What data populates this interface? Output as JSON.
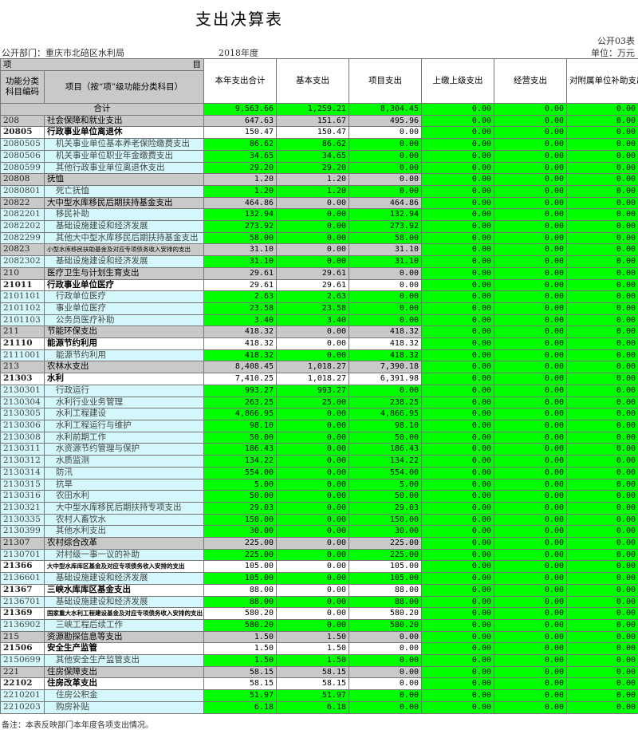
{
  "title": "支出决算表",
  "form_no": "公开03表",
  "department": "公开部门：重庆市北碚区水利局",
  "year": "2018年度",
  "unit": "单位：万元",
  "header": {
    "item_label": "项",
    "item_label_right": "目",
    "code": "功能分类科目编码",
    "name": "项目（按“项”级功能分类科目）",
    "col1": "本年支出合计",
    "col2": "基本支出",
    "col3": "项目支出",
    "col4": "上缴上级支出",
    "col5": "经营支出",
    "col6": "对附属单位补助支出"
  },
  "rows": [
    {
      "code": "",
      "name": "合计",
      "v": [
        "9,563.66",
        "1,259.21",
        "8,304.45",
        "0.00",
        "0.00",
        "0.00"
      ],
      "type": "total"
    },
    {
      "code": "208",
      "name": "社会保障和就业支出",
      "v": [
        "647.63",
        "151.67",
        "495.96",
        "0.00",
        "0.00",
        "0.00"
      ],
      "type": "grey"
    },
    {
      "code": "20805",
      "name": "行政事业单位离退休",
      "v": [
        "150.47",
        "150.47",
        "0.00",
        "0.00",
        "0.00",
        "0.00"
      ],
      "type": "white"
    },
    {
      "code": "2080505",
      "name": "机关事业单位基本养老保险缴费支出",
      "v": [
        "86.62",
        "86.62",
        "0.00",
        "0.00",
        "0.00",
        "0.00"
      ],
      "type": "light"
    },
    {
      "code": "2080506",
      "name": "机关事业单位职业年金缴费支出",
      "v": [
        "34.65",
        "34.65",
        "0.00",
        "0.00",
        "0.00",
        "0.00"
      ],
      "type": "light"
    },
    {
      "code": "2080599",
      "name": "其他行政事业单位离退休支出",
      "v": [
        "29.20",
        "29.20",
        "0.00",
        "0.00",
        "0.00",
        "0.00"
      ],
      "type": "light"
    },
    {
      "code": "20808",
      "name": "抚恤",
      "v": [
        "1.20",
        "1.20",
        "0.00",
        "0.00",
        "0.00",
        "0.00"
      ],
      "type": "grey"
    },
    {
      "code": "2080801",
      "name": "死亡抚恤",
      "v": [
        "1.20",
        "1.20",
        "0.00",
        "0.00",
        "0.00",
        "0.00"
      ],
      "type": "light"
    },
    {
      "code": "20822",
      "name": "大中型水库移民后期扶持基金支出",
      "v": [
        "464.86",
        "0.00",
        "464.86",
        "0.00",
        "0.00",
        "0.00"
      ],
      "type": "grey"
    },
    {
      "code": "2082201",
      "name": "移民补助",
      "v": [
        "132.94",
        "0.00",
        "132.94",
        "0.00",
        "0.00",
        "0.00"
      ],
      "type": "light"
    },
    {
      "code": "2082202",
      "name": "基础设施建设和经济发展",
      "v": [
        "273.92",
        "0.00",
        "273.92",
        "0.00",
        "0.00",
        "0.00"
      ],
      "type": "light"
    },
    {
      "code": "2082299",
      "name": "其他大中型水库移民后期扶持基金支出",
      "v": [
        "58.00",
        "0.00",
        "58.00",
        "0.00",
        "0.00",
        "0.00"
      ],
      "type": "light"
    },
    {
      "code": "20823",
      "name": "小型水库移民扶助基金及对应专项债务收入安排的支出",
      "v": [
        "31.10",
        "0.00",
        "31.10",
        "0.00",
        "0.00",
        "0.00"
      ],
      "type": "grey",
      "small": true
    },
    {
      "code": "2082302",
      "name": "基础设施建设和经济发展",
      "v": [
        "31.10",
        "0.00",
        "31.10",
        "0.00",
        "0.00",
        "0.00"
      ],
      "type": "light"
    },
    {
      "code": "210",
      "name": "医疗卫生与计划生育支出",
      "v": [
        "29.61",
        "29.61",
        "0.00",
        "0.00",
        "0.00",
        "0.00"
      ],
      "type": "grey"
    },
    {
      "code": "21011",
      "name": "行政事业单位医疗",
      "v": [
        "29.61",
        "29.61",
        "0.00",
        "0.00",
        "0.00",
        "0.00"
      ],
      "type": "white"
    },
    {
      "code": "2101101",
      "name": "行政单位医疗",
      "v": [
        "2.63",
        "2.63",
        "0.00",
        "0.00",
        "0.00",
        "0.00"
      ],
      "type": "light"
    },
    {
      "code": "2101102",
      "name": "事业单位医疗",
      "v": [
        "23.58",
        "23.58",
        "0.00",
        "0.00",
        "0.00",
        "0.00"
      ],
      "type": "light"
    },
    {
      "code": "2101103",
      "name": "公务员医疗补助",
      "v": [
        "3.40",
        "3.40",
        "0.00",
        "0.00",
        "0.00",
        "0.00"
      ],
      "type": "light"
    },
    {
      "code": "211",
      "name": "节能环保支出",
      "v": [
        "418.32",
        "0.00",
        "418.32",
        "0.00",
        "0.00",
        "0.00"
      ],
      "type": "grey"
    },
    {
      "code": "21110",
      "name": "能源节约利用",
      "v": [
        "418.32",
        "0.00",
        "418.32",
        "0.00",
        "0.00",
        "0.00"
      ],
      "type": "white"
    },
    {
      "code": "2111001",
      "name": "能源节约利用",
      "v": [
        "418.32",
        "0.00",
        "418.32",
        "0.00",
        "0.00",
        "0.00"
      ],
      "type": "light"
    },
    {
      "code": "213",
      "name": "农林水支出",
      "v": [
        "8,408.45",
        "1,018.27",
        "7,390.18",
        "0.00",
        "0.00",
        "0.00"
      ],
      "type": "grey"
    },
    {
      "code": "21303",
      "name": "水利",
      "v": [
        "7,410.25",
        "1,018.27",
        "6,391.98",
        "0.00",
        "0.00",
        "0.00"
      ],
      "type": "white"
    },
    {
      "code": "2130301",
      "name": "行政运行",
      "v": [
        "993.27",
        "993.27",
        "0.00",
        "0.00",
        "0.00",
        "0.00"
      ],
      "type": "light"
    },
    {
      "code": "2130304",
      "name": "水利行业业务管理",
      "v": [
        "263.25",
        "25.00",
        "238.25",
        "0.00",
        "0.00",
        "0.00"
      ],
      "type": "light"
    },
    {
      "code": "2130305",
      "name": "水利工程建设",
      "v": [
        "4,866.95",
        "0.00",
        "4,866.95",
        "0.00",
        "0.00",
        "0.00"
      ],
      "type": "light"
    },
    {
      "code": "2130306",
      "name": "水利工程运行与维护",
      "v": [
        "98.10",
        "0.00",
        "98.10",
        "0.00",
        "0.00",
        "0.00"
      ],
      "type": "light"
    },
    {
      "code": "2130308",
      "name": "水利前期工作",
      "v": [
        "50.00",
        "0.00",
        "50.00",
        "0.00",
        "0.00",
        "0.00"
      ],
      "type": "light"
    },
    {
      "code": "2130311",
      "name": "水资源节约管理与保护",
      "v": [
        "186.43",
        "0.00",
        "186.43",
        "0.00",
        "0.00",
        "0.00"
      ],
      "type": "light"
    },
    {
      "code": "2130312",
      "name": "水质监测",
      "v": [
        "134.22",
        "0.00",
        "134.22",
        "0.00",
        "0.00",
        "0.00"
      ],
      "type": "light"
    },
    {
      "code": "2130314",
      "name": "防汛",
      "v": [
        "554.00",
        "0.00",
        "554.00",
        "0.00",
        "0.00",
        "0.00"
      ],
      "type": "light"
    },
    {
      "code": "2130315",
      "name": "抗旱",
      "v": [
        "5.00",
        "0.00",
        "5.00",
        "0.00",
        "0.00",
        "0.00"
      ],
      "type": "light"
    },
    {
      "code": "2130316",
      "name": "农田水利",
      "v": [
        "50.00",
        "0.00",
        "50.00",
        "0.00",
        "0.00",
        "0.00"
      ],
      "type": "light"
    },
    {
      "code": "2130321",
      "name": "大中型水库移民后期扶持专项支出",
      "v": [
        "29.03",
        "0.00",
        "29.03",
        "0.00",
        "0.00",
        "0.00"
      ],
      "type": "light"
    },
    {
      "code": "2130335",
      "name": "农村人畜饮水",
      "v": [
        "150.00",
        "0.00",
        "150.00",
        "0.00",
        "0.00",
        "0.00"
      ],
      "type": "light"
    },
    {
      "code": "2130399",
      "name": "其他水利支出",
      "v": [
        "30.00",
        "0.00",
        "30.00",
        "0.00",
        "0.00",
        "0.00"
      ],
      "type": "light"
    },
    {
      "code": "21307",
      "name": "农村综合改革",
      "v": [
        "225.00",
        "0.00",
        "225.00",
        "0.00",
        "0.00",
        "0.00"
      ],
      "type": "grey"
    },
    {
      "code": "2130701",
      "name": "对村级一事一议的补助",
      "v": [
        "225.00",
        "0.00",
        "225.00",
        "0.00",
        "0.00",
        "0.00"
      ],
      "type": "light"
    },
    {
      "code": "21366",
      "name": "大中型水库库区基金及对应专项债务收入安排的支出",
      "v": [
        "105.00",
        "0.00",
        "105.00",
        "0.00",
        "0.00",
        "0.00"
      ],
      "type": "white",
      "small": true
    },
    {
      "code": "2136601",
      "name": "基础设施建设和经济发展",
      "v": [
        "105.00",
        "0.00",
        "105.00",
        "0.00",
        "0.00",
        "0.00"
      ],
      "type": "light"
    },
    {
      "code": "21367",
      "name": "三峡水库库区基金支出",
      "v": [
        "88.00",
        "0.00",
        "88.00",
        "0.00",
        "0.00",
        "0.00"
      ],
      "type": "white"
    },
    {
      "code": "2136701",
      "name": "基础设施建设和经济发展",
      "v": [
        "88.00",
        "0.00",
        "88.00",
        "0.00",
        "0.00",
        "0.00"
      ],
      "type": "light"
    },
    {
      "code": "21369",
      "name": "国家重大水利工程建设基金及对应专项债务收入安排的支出",
      "v": [
        "580.20",
        "0.00",
        "580.20",
        "0.00",
        "0.00",
        "0.00"
      ],
      "type": "white",
      "small": true
    },
    {
      "code": "2136902",
      "name": "三峡工程后续工作",
      "v": [
        "580.20",
        "0.00",
        "580.20",
        "0.00",
        "0.00",
        "0.00"
      ],
      "type": "light"
    },
    {
      "code": "215",
      "name": "资源勘探信息等支出",
      "v": [
        "1.50",
        "1.50",
        "0.00",
        "0.00",
        "0.00",
        "0.00"
      ],
      "type": "grey"
    },
    {
      "code": "21506",
      "name": "安全生产监管",
      "v": [
        "1.50",
        "1.50",
        "0.00",
        "0.00",
        "0.00",
        "0.00"
      ],
      "type": "white"
    },
    {
      "code": "2150699",
      "name": "其他安全生产监管支出",
      "v": [
        "1.50",
        "1.50",
        "0.00",
        "0.00",
        "0.00",
        "0.00"
      ],
      "type": "light"
    },
    {
      "code": "221",
      "name": "住房保障支出",
      "v": [
        "58.15",
        "58.15",
        "0.00",
        "0.00",
        "0.00",
        "0.00"
      ],
      "type": "grey"
    },
    {
      "code": "22102",
      "name": "住房改革支出",
      "v": [
        "58.15",
        "58.15",
        "0.00",
        "0.00",
        "0.00",
        "0.00"
      ],
      "type": "white"
    },
    {
      "code": "2210201",
      "name": "住房公积金",
      "v": [
        "51.97",
        "51.97",
        "0.00",
        "0.00",
        "0.00",
        "0.00"
      ],
      "type": "light"
    },
    {
      "code": "2210203",
      "name": "购房补贴",
      "v": [
        "6.18",
        "6.18",
        "0.00",
        "0.00",
        "0.00",
        "0.00"
      ],
      "type": "light"
    }
  ],
  "footer": "备注：本表反映部门本年度各项支出情况。"
}
